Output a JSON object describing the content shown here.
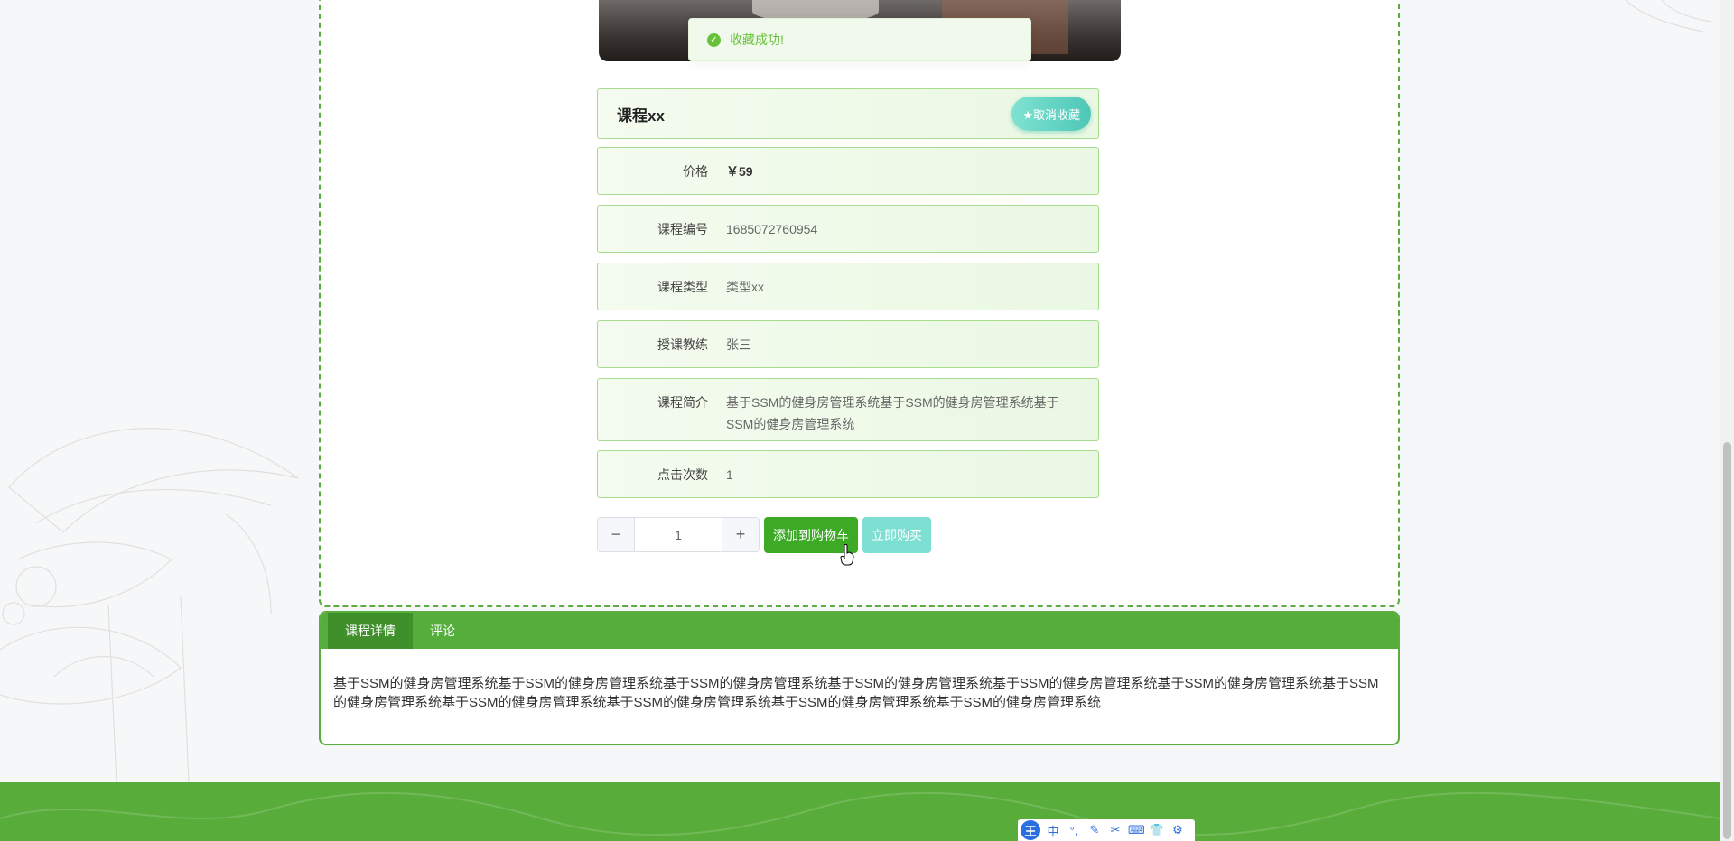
{
  "toast": {
    "message": "收藏成功!"
  },
  "course": {
    "title": "课程xx",
    "favorite_button": "★取消收藏",
    "fields": [
      {
        "label": "价格",
        "value": "￥59"
      },
      {
        "label": "课程编号",
        "value": "1685072760954"
      },
      {
        "label": "课程类型",
        "value": "类型xx"
      },
      {
        "label": "授课教练",
        "value": "张三"
      },
      {
        "label": "课程简介",
        "value": "基于SSM的健身房管理系统基于SSM的健身房管理系统基于SSM的健身房管理系统"
      },
      {
        "label": "点击次数",
        "value": "1"
      }
    ]
  },
  "purchase": {
    "minus": "−",
    "plus": "+",
    "quantity": "1",
    "add_to_cart": "添加到购物车",
    "buy_now": "立即购买"
  },
  "detail": {
    "tabs": [
      "课程详情",
      "评论"
    ],
    "content": "基于SSM的健身房管理系统基于SSM的健身房管理系统基于SSM的健身房管理系统基于SSM的健身房管理系统基于SSM的健身房管理系统基于SSM的健身房管理系统基于SSM的健身房管理系统基于SSM的健身房管理系统基于SSM的健身房管理系统基于SSM的健身房管理系统基于SSM的健身房管理系统"
  },
  "ime_toolbar": {
    "logo": "王",
    "mode": "中",
    "items": [
      "°,",
      "✎",
      "✂",
      "⌨",
      "👕",
      "⚙"
    ]
  },
  "colors": {
    "primary_green": "#3daa26",
    "footer_green": "#58ac3a",
    "teal_button": "#7cdfd2",
    "toast_green": "#67c23a"
  }
}
